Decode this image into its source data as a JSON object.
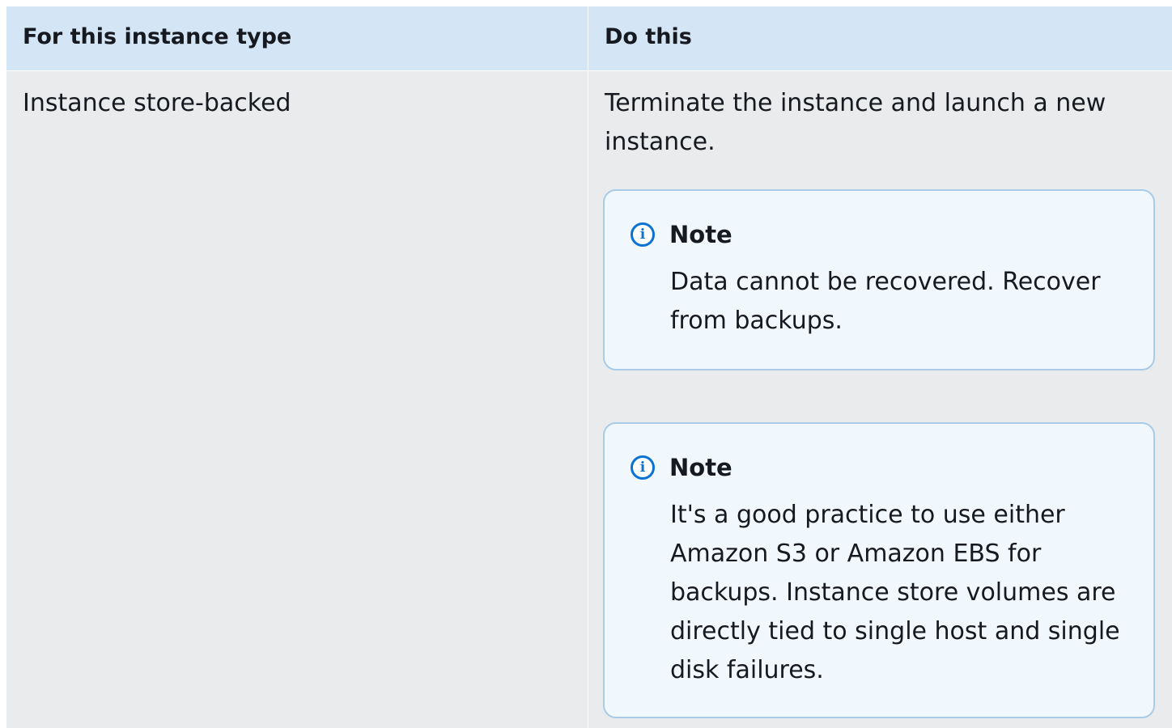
{
  "table": {
    "headers": [
      "For this instance type",
      "Do this"
    ],
    "row": {
      "instance_type": "Instance store-backed",
      "action": "Terminate the instance and launch a new instance.",
      "notes": [
        {
          "title": "Note",
          "icon": "info-icon",
          "body": "Data cannot be recovered. Recover from backups."
        },
        {
          "title": "Note",
          "icon": "info-icon",
          "body": "It's a good practice to use either Amazon S3 or Amazon EBS for backups. Instance store volumes are directly tied to single host and single disk failures."
        }
      ]
    }
  },
  "colors": {
    "header_bg": "#d4e5f6",
    "cell_bg": "#e9ebed",
    "note_bg": "#f0f8fd",
    "note_border": "#a9cbe8",
    "info_accent": "#0972d3"
  }
}
